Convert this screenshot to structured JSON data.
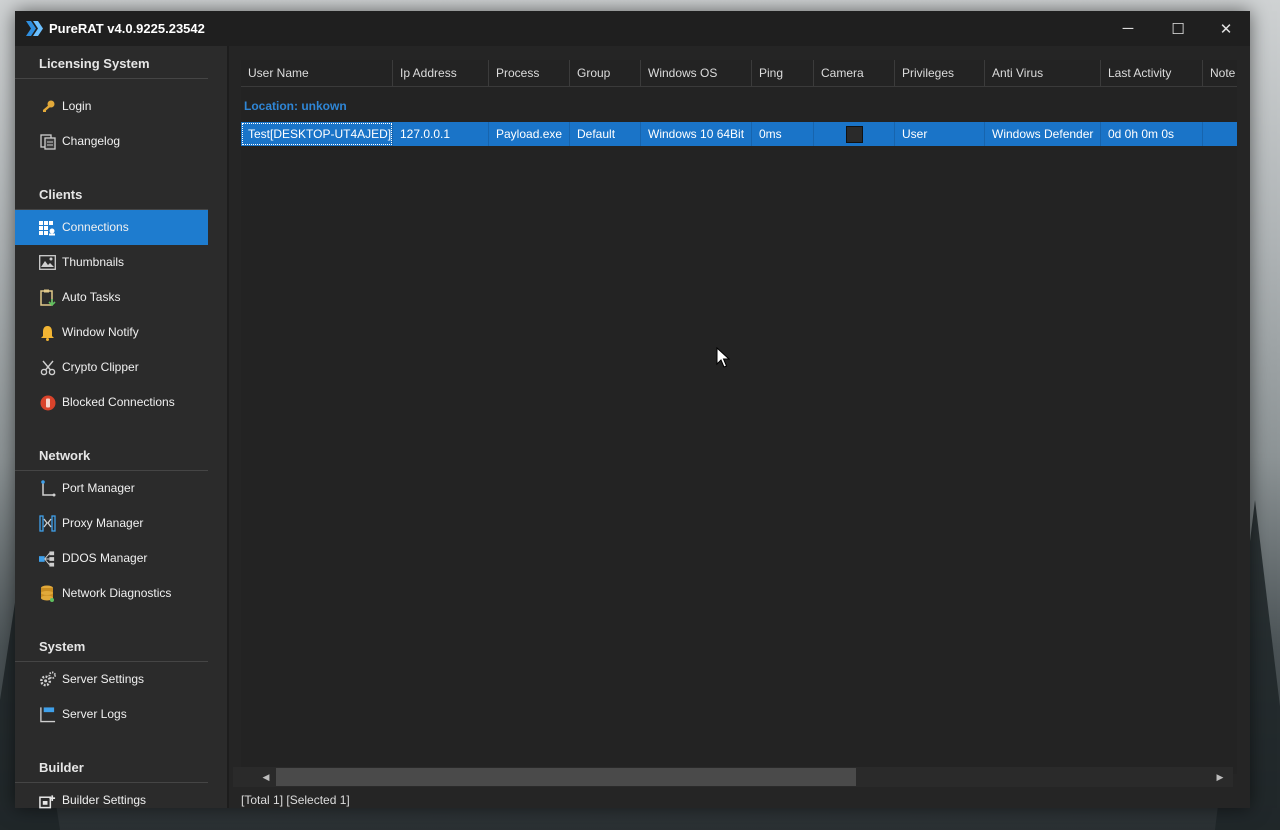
{
  "app": {
    "title": "PureRAT v4.0.9225.23542",
    "window_controls": {
      "minimize": "─",
      "maximize": "☐",
      "close": "✕"
    }
  },
  "sidebar": {
    "sections": [
      {
        "title": "Licensing System",
        "items": [
          {
            "label": "Login",
            "icon": "key-icon"
          },
          {
            "label": "Changelog",
            "icon": "changelog-icon"
          }
        ]
      },
      {
        "title": "Clients",
        "items": [
          {
            "label": "Connections",
            "icon": "connections-icon",
            "active": true
          },
          {
            "label": "Thumbnails",
            "icon": "image-icon"
          },
          {
            "label": "Auto Tasks",
            "icon": "clipboard-icon"
          },
          {
            "label": "Window Notify",
            "icon": "bell-icon"
          },
          {
            "label": "Crypto Clipper",
            "icon": "scissors-icon"
          },
          {
            "label": "Blocked Connections",
            "icon": "blocked-icon"
          }
        ]
      },
      {
        "title": "Network",
        "items": [
          {
            "label": "Port Manager",
            "icon": "port-icon"
          },
          {
            "label": "Proxy Manager",
            "icon": "proxy-icon"
          },
          {
            "label": "DDOS Manager",
            "icon": "ddos-icon"
          },
          {
            "label": "Network Diagnostics",
            "icon": "database-icon"
          }
        ]
      },
      {
        "title": "System",
        "items": [
          {
            "label": "Server Settings",
            "icon": "gear-icon"
          },
          {
            "label": "Server Logs",
            "icon": "log-icon"
          }
        ]
      },
      {
        "title": "Builder",
        "items": [
          {
            "label": "Builder Settings",
            "icon": "builder-icon"
          }
        ]
      }
    ]
  },
  "grid": {
    "columns": [
      "User Name",
      "Ip Address",
      "Process",
      "Group",
      "Windows OS",
      "Ping",
      "Camera",
      "Privileges",
      "Anti Virus",
      "Last Activity",
      "Note"
    ],
    "group_header": "Location: unkown",
    "rows": [
      {
        "user_name": "Test[DESKTOP-UT4AJED]",
        "ip_address": "127.0.0.1",
        "process": "Payload.exe",
        "group": "Default",
        "windows_os": "Windows 10 64Bit",
        "ping": "0ms",
        "camera": "",
        "privileges": "User",
        "anti_virus": "Windows Defender",
        "last_activity": "0d 0h 0m 0s",
        "note": ""
      }
    ]
  },
  "status": {
    "total": "[Total 1]",
    "selected": "[Selected 1]"
  },
  "colors": {
    "accent": "#1e7ccf",
    "group_header": "#2f86d6",
    "background": "#252525",
    "sidebar": "#2b2b2b"
  }
}
